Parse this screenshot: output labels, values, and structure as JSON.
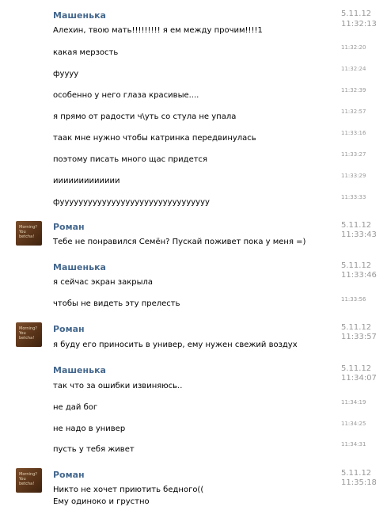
{
  "messages": [
    {
      "author": "Машенька",
      "date": "5.11.12",
      "time": "11:32:13",
      "text": "Алехин, твою мать!!!!!!!!! я ем между прочим!!!!1"
    },
    {
      "time": "11:32:20",
      "text": "какая мерзость"
    },
    {
      "time": "11:32:24",
      "text": "фуууу"
    },
    {
      "time": "11:32:39",
      "text": "особенно у него глаза красивые...."
    },
    {
      "time": "11:32:57",
      "text": "я прямо от радости ч\\уть со стула не упала"
    },
    {
      "time": "11:33:16",
      "text": "таак мне нужно чтобы катринка передвинулась"
    },
    {
      "time": "11:33:27",
      "text": "поэтому писать много щас придется"
    },
    {
      "time": "11:33:29",
      "text": "иииииииииииии"
    },
    {
      "time": "11:33:33",
      "text": "фуууууууууууууууууууууууууууууууу"
    },
    {
      "author": "Роман",
      "date": "5.11.12",
      "time": "11:33:43",
      "text": "Тебе не понравился Семён? Пускай поживет пока у меня =)",
      "avatar_text": "Morning? You betcha!"
    },
    {
      "author": "Машенька",
      "date": "5.11.12",
      "time": "11:33:46",
      "text": "я сейчас экран закрыла"
    },
    {
      "time": "11:33:56",
      "text": "чтобы не видеть эту прелесть"
    },
    {
      "author": "Роман",
      "date": "5.11.12",
      "time": "11:33:57",
      "text": "я буду его приносить в универ, ему нужен свежий воздух",
      "avatar_text": "Morning? You betcha!"
    },
    {
      "author": "Машенька",
      "date": "5.11.12",
      "time": "11:34:07",
      "text": "так что за ошибки извиняюсь.."
    },
    {
      "time": "11:34:19",
      "text": "не дай бог"
    },
    {
      "time": "11:34:25",
      "text": "не надо в универ"
    },
    {
      "time": "11:34:31",
      "text": "пусть у тебя живет"
    },
    {
      "author": "Роман",
      "date": "5.11.12",
      "time": "11:35:18",
      "text": "Никто не хочет приютить бедного((",
      "text2": "Ему одиноко и грустно",
      "avatar_text": "Morning? You betcha!"
    }
  ],
  "colors": {
    "author": "#45688e",
    "meta": "#999999",
    "text": "#000000",
    "avatar": "#5a3419"
  }
}
